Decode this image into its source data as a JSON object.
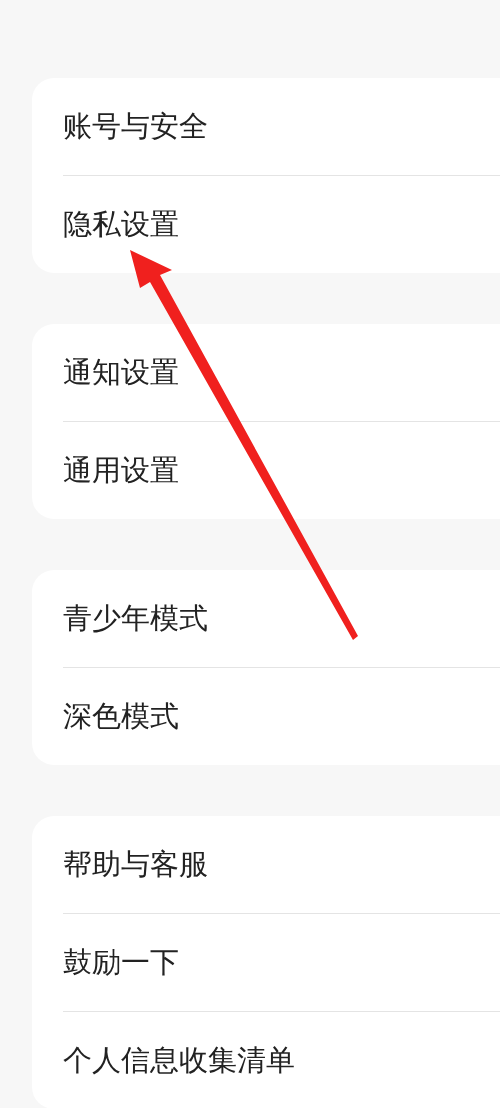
{
  "groups": [
    {
      "items": [
        {
          "label": "账号与安全"
        },
        {
          "label": "隐私设置"
        }
      ]
    },
    {
      "items": [
        {
          "label": "通知设置"
        },
        {
          "label": "通用设置"
        }
      ]
    },
    {
      "items": [
        {
          "label": "青少年模式"
        },
        {
          "label": "深色模式"
        }
      ]
    },
    {
      "items": [
        {
          "label": "帮助与客服"
        },
        {
          "label": "鼓励一下"
        },
        {
          "label": "个人信息收集清单"
        }
      ]
    }
  ]
}
